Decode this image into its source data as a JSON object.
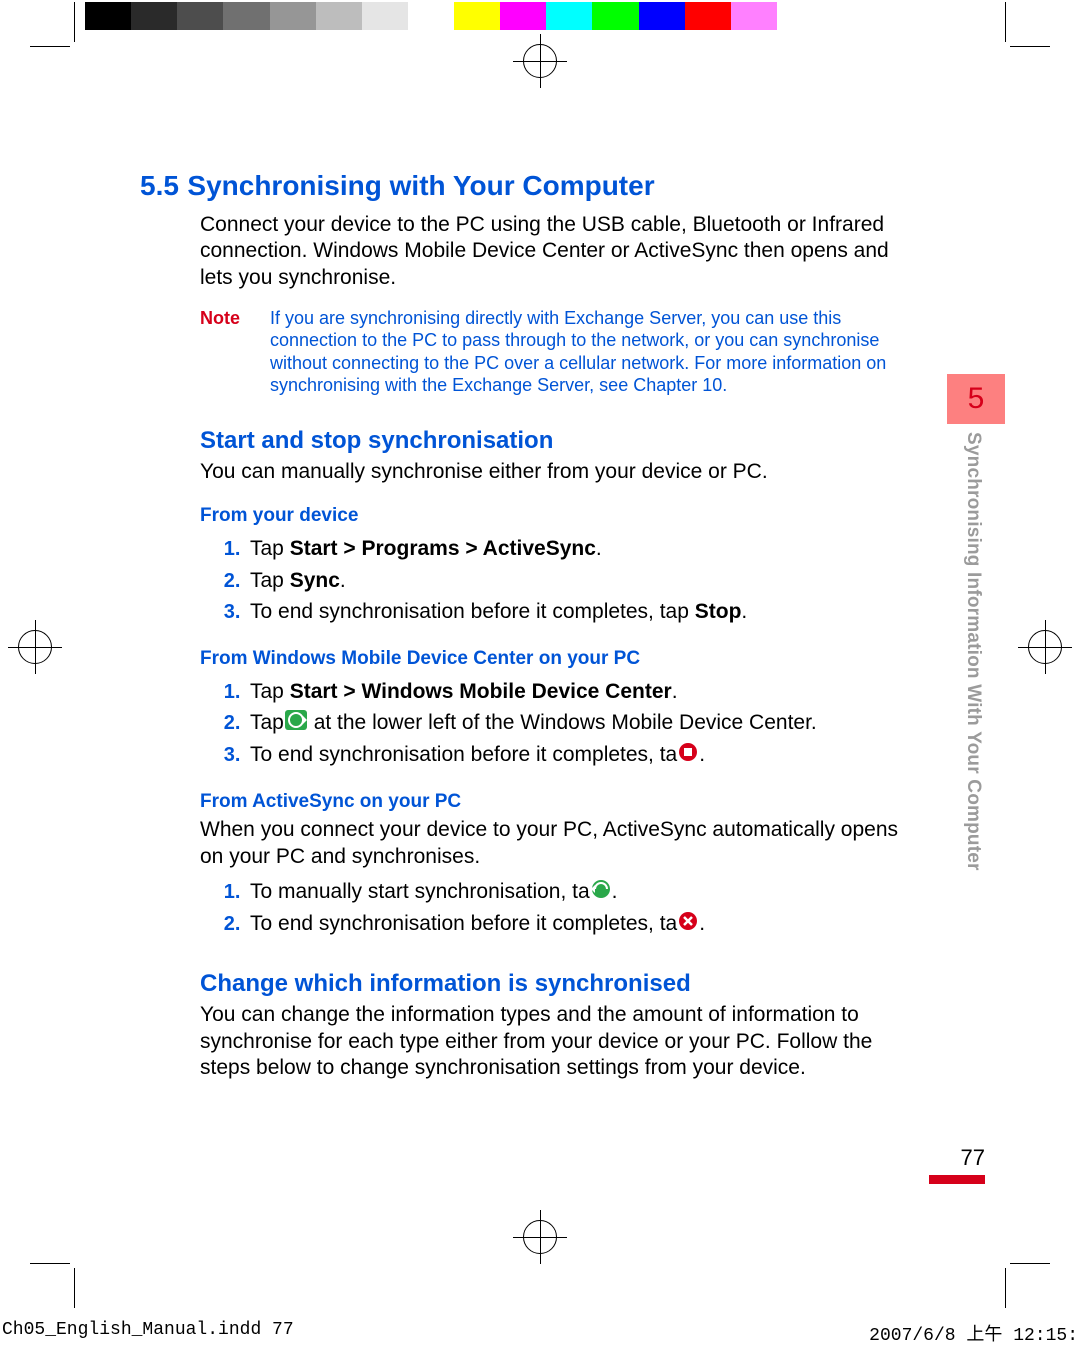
{
  "colorbar": [
    "#000000",
    "#2a2a2a",
    "#4d4d4d",
    "#707070",
    "#969696",
    "#bdbdbd",
    "#e5e5e5",
    "#ffffff",
    "#ffff00",
    "#ff00ff",
    "#00ffff",
    "#00ff00",
    "#0000ff",
    "#ff0000",
    "#ff80ff",
    "#ffffff"
  ],
  "section": {
    "number": "5.5",
    "title": "Synchronising with Your Computer",
    "intro": "Connect your device to the PC using the USB cable, Bluetooth or Infrared connection. Windows Mobile Device Center or ActiveSync then opens and lets you synchronise."
  },
  "note": {
    "label": "Note",
    "body": "If you are synchronising directly with Exchange Server, you can use this connection to the PC to  pass through  to the network, or you can synchronise without connecting to the PC over a cellular network. For more information on synchronising with the Exchange Server, see Chapter 10."
  },
  "startstop": {
    "heading": "Start and stop synchronisation",
    "intro": "You can manually synchronise either from your device or PC.",
    "fromDevice": {
      "heading": "From your device",
      "steps": [
        {
          "pre": "Tap ",
          "bold": "Start > Programs > ActiveSync",
          "post": "."
        },
        {
          "pre": "Tap ",
          "bold": "Sync",
          "post": "."
        },
        {
          "pre": "To end synchronisation before it completes, tap ",
          "bold": "Stop",
          "post": "."
        }
      ]
    },
    "fromWMDC": {
      "heading": "From Windows Mobile Device Center on your PC",
      "step1_pre": "Tap ",
      "step1_bold": "Start > Windows Mobile Device Center",
      "step1_post": ".",
      "step2_pre": "Tap",
      "step2_post": " at the lower left of the Windows Mobile Device Center.",
      "step3_pre": "To end synchronisation before it completes, ta",
      "step3_post": "."
    },
    "fromAS": {
      "heading": "From ActiveSync on your PC",
      "intro": "When you connect your device to your PC, ActiveSync automatically opens on your PC and synchronises.",
      "step1_pre": "To manually start synchronisation, ta",
      "step1_post": ".",
      "step2_pre": "To end synchronisation before it completes, ta",
      "step2_post": "."
    }
  },
  "change": {
    "heading": "Change which information is synchronised",
    "body": "You can change the information types and the amount of information to synchronise for each type either from your device or your PC. Follow the steps below to change synchronisation settings from your device."
  },
  "tab": {
    "chapter": "5",
    "title": "Synchronising Information With Your Computer"
  },
  "pageNumber": "77",
  "footer": {
    "left": "Ch05_English_Manual.indd   77",
    "right": "2007/6/8   上午 12:15:"
  }
}
